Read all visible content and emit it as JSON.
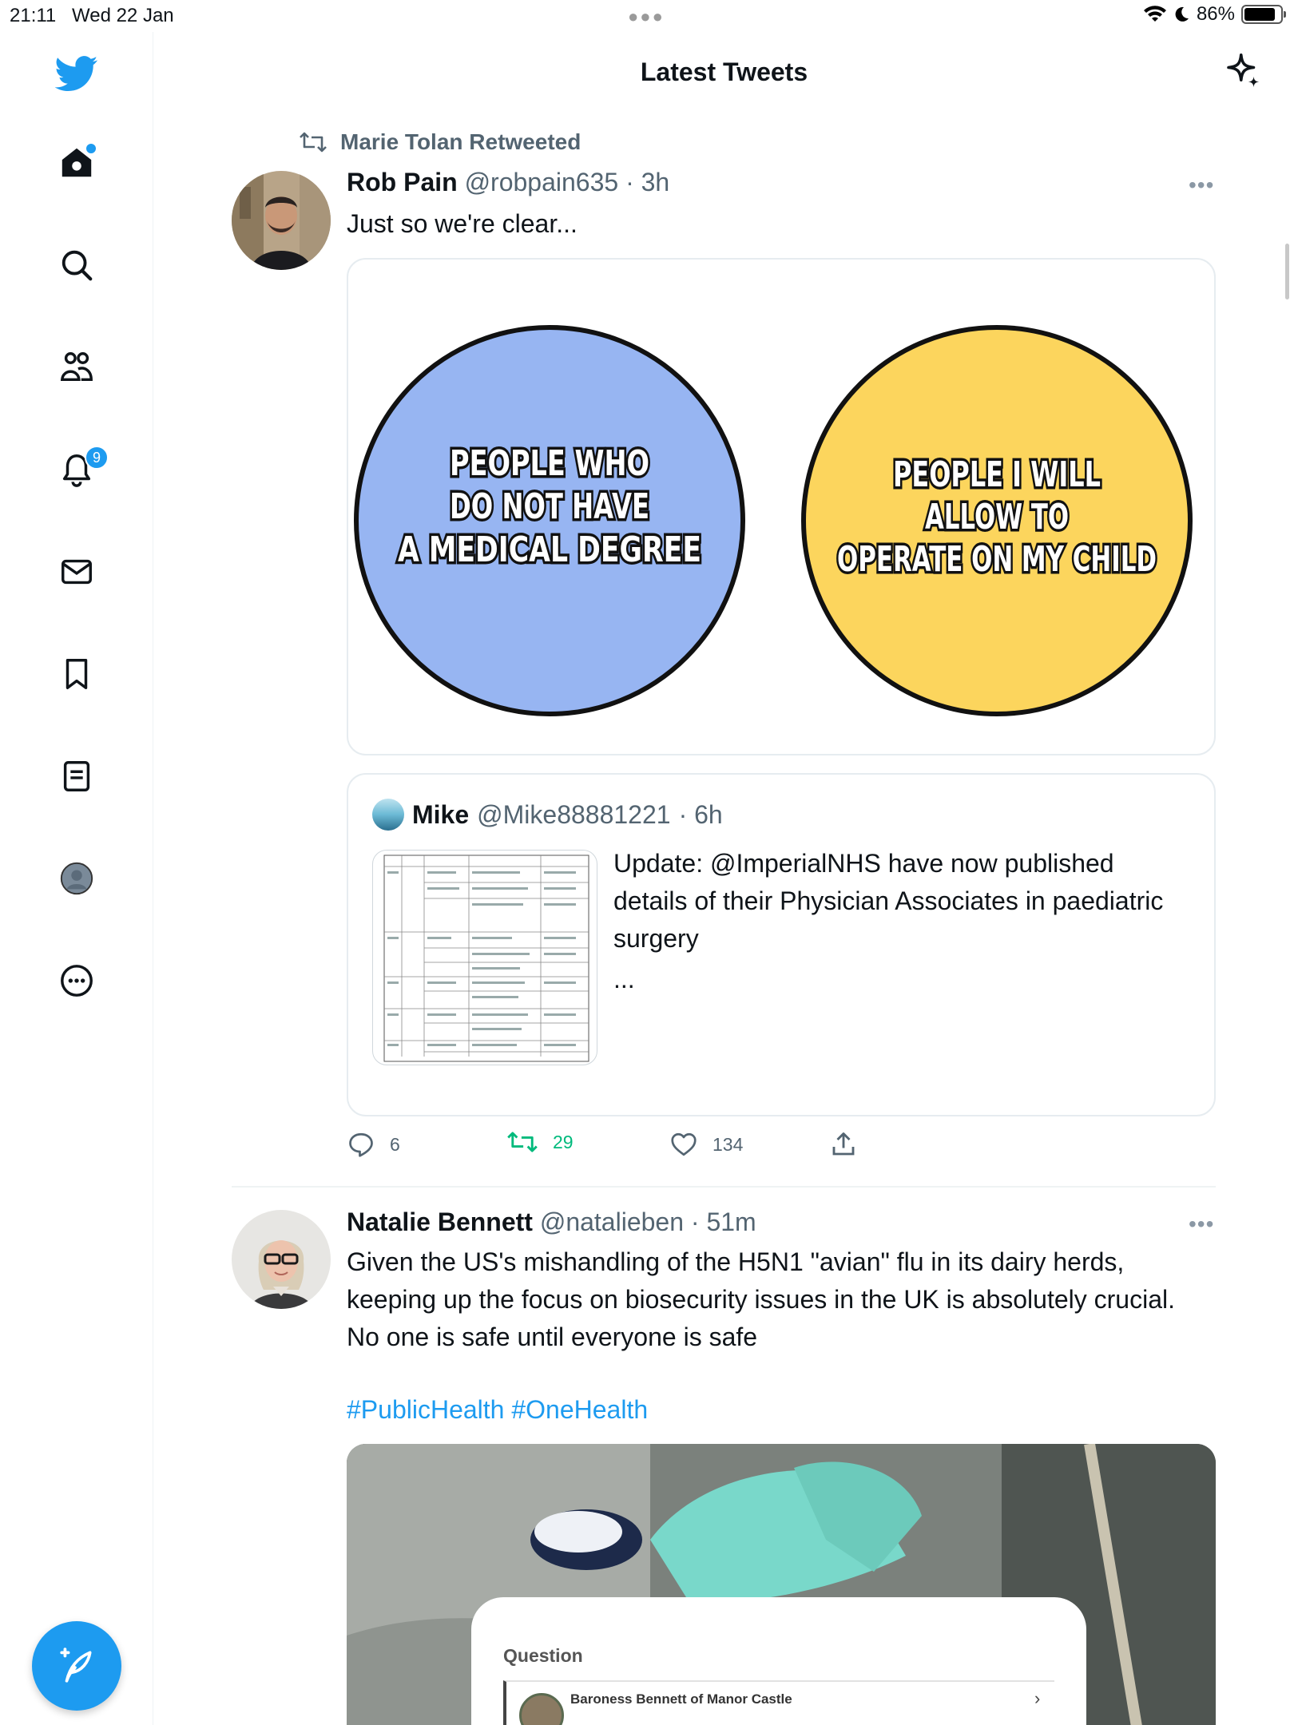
{
  "status_bar": {
    "time": "21:11",
    "date": "Wed 22 Jan",
    "battery": "86%",
    "battery_level": 0.86
  },
  "nav": {
    "items": [
      {
        "icon": "home-icon",
        "has_dot": true
      },
      {
        "icon": "search-icon"
      },
      {
        "icon": "communities-icon"
      },
      {
        "icon": "bell-icon",
        "badge": "9"
      },
      {
        "icon": "mail-icon"
      },
      {
        "icon": "bookmark-icon"
      },
      {
        "icon": "lists-icon"
      },
      {
        "icon": "profile-icon"
      },
      {
        "icon": "more-circle-icon"
      }
    ],
    "accent": "#1d9bf0"
  },
  "header": {
    "title": "Latest Tweets"
  },
  "tweets": [
    {
      "retweeted_by": "Marie Tolan Retweeted",
      "name": "Rob Pain",
      "handle": "@robpain635",
      "time": "· 3h",
      "more": "•••",
      "text": "Just so we're clear...",
      "media": {
        "left_circle_text": [
          "PEOPLE WHO",
          "DO NOT HAVE",
          "A MEDICAL DEGREE"
        ],
        "right_circle_text": [
          "PEOPLE I WILL",
          "ALLOW TO",
          "OPERATE ON MY CHILD"
        ],
        "left_color": "#97b5f2",
        "right_color": "#fcd55d"
      },
      "quote": {
        "name": "Mike",
        "handle": "@Mike88881221",
        "time": "· 6h",
        "text": "Update: @ImperialNHS have now published details of their Physician Associates in paediatric surgery",
        "ellipsis": "..."
      },
      "actions": {
        "replies": "6",
        "retweets": "29",
        "likes": "134"
      }
    },
    {
      "name": "Natalie Bennett",
      "handle": "@natalieben",
      "time": "· 51m",
      "more": "•••",
      "text": "Given the US's mishandling of the H5N1 \"avian\" flu in its dairy herds, keeping up the focus on biosecurity issues in the UK is absolutely crucial. No one is safe until everyone is safe",
      "hashtags": "#PublicHealth #OneHealth",
      "media": {
        "card_label": "Question",
        "card_person": "Baroness Bennett of Manor Castle",
        "card_chevron": "›"
      }
    }
  ]
}
